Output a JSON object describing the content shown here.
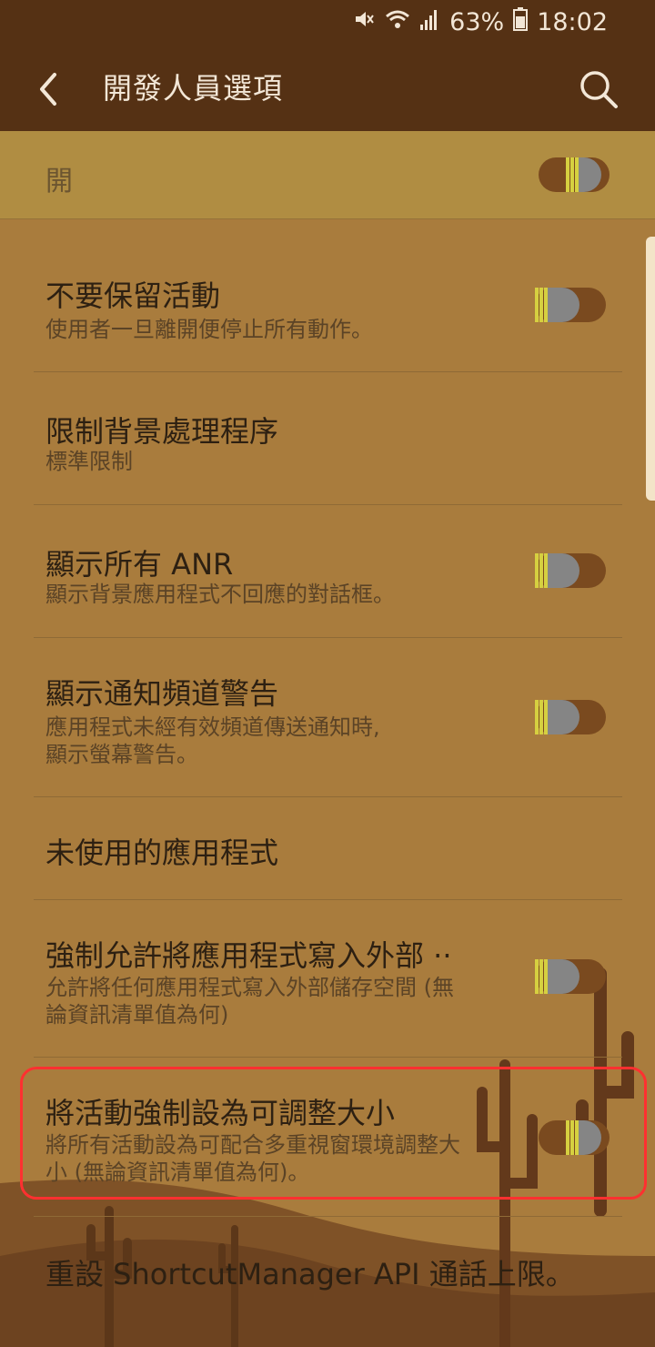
{
  "status": {
    "battery_percent": "63%",
    "time": "18:02"
  },
  "appbar": {
    "title": "開發人員選項"
  },
  "master": {
    "label": "開",
    "enabled": true
  },
  "items": [
    {
      "title": "不要保留活動",
      "subtitle": "使用者一旦離開便停止所有動作。",
      "toggle": "off"
    },
    {
      "title": "限制背景處理程序",
      "subtitle": "標準限制",
      "toggle": "none"
    },
    {
      "title": "顯示所有 ANR",
      "subtitle": "顯示背景應用程式不回應的對話框。",
      "toggle": "off"
    },
    {
      "title": "顯示通知頻道警告",
      "subtitle_lines": [
        "應用程式未經有效頻道傳送通知時,",
        "顯示螢幕警告。"
      ],
      "toggle": "off"
    },
    {
      "title": "未使用的應用程式",
      "toggle": "none"
    },
    {
      "title": "強制允許將應用程式寫入外部 ··",
      "subtitle_lines": [
        "允許將任何應用程式寫入外部儲存空間 (無",
        "論資訊清單值為何)"
      ],
      "toggle": "off"
    },
    {
      "title": "將活動強制設為可調整大小",
      "subtitle_lines": [
        "將所有活動設為可配合多重視窗環境調整大",
        "小 (無論資訊清單值為何)。"
      ],
      "toggle": "on"
    },
    {
      "title": "重設 ShortcutManager API 通話上限。",
      "toggle": "none"
    }
  ],
  "colors": {
    "appbar": "#553114",
    "background": "#a97c3d",
    "toggle_track_on": "#7a4a1f",
    "toggle_thumb": "#858585",
    "toggle_stripes": "#d6d040",
    "highlight": "#ff3030"
  },
  "icons": [
    "mute-icon",
    "wifi-icon",
    "signal-icon",
    "battery-icon",
    "back-arrow-icon",
    "search-icon"
  ]
}
